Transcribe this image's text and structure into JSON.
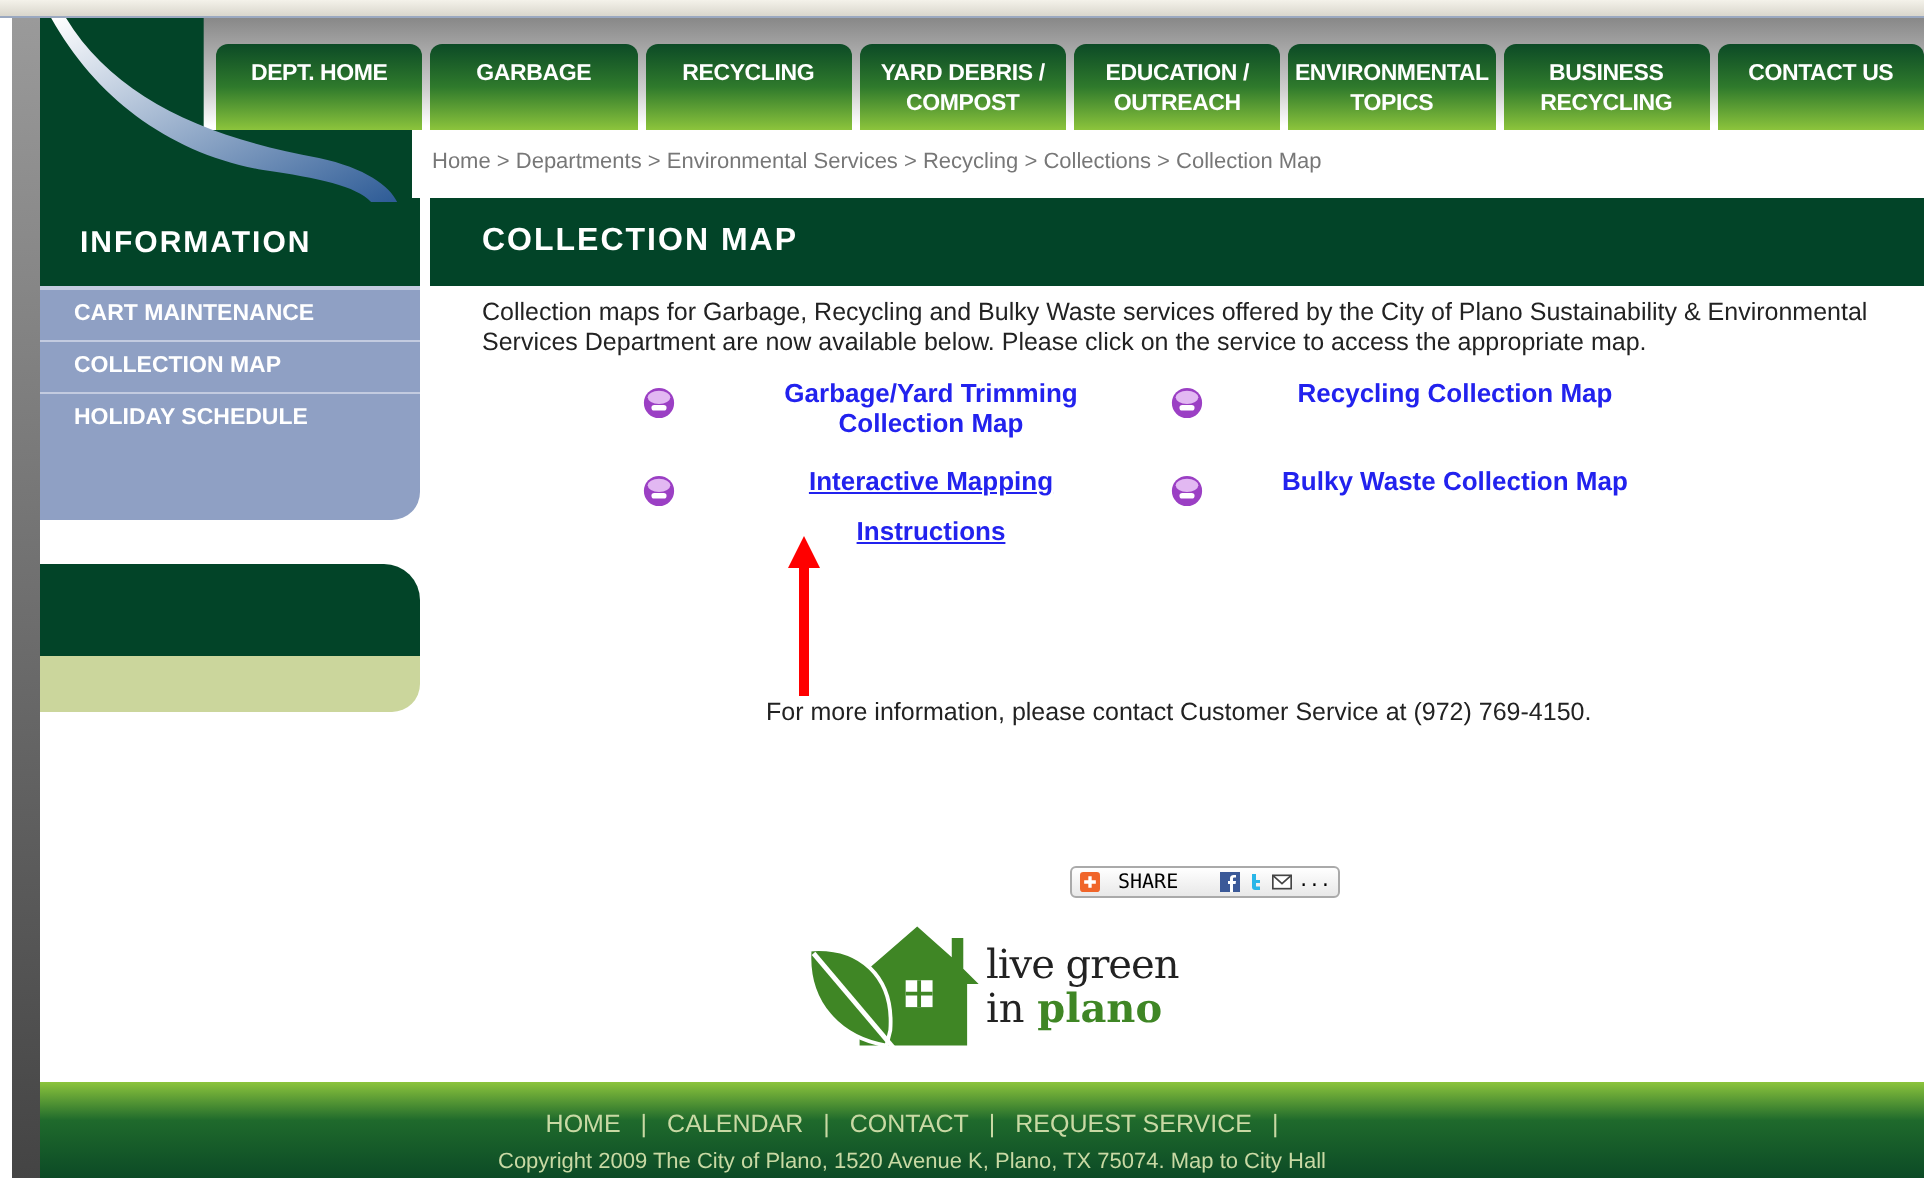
{
  "tabs": [
    {
      "label": "DEPT. HOME"
    },
    {
      "label": "GARBAGE"
    },
    {
      "label": "RECYCLING"
    },
    {
      "label": "YARD DEBRIS / COMPOST"
    },
    {
      "label": "EDUCATION / OUTREACH"
    },
    {
      "label": "ENVIRONMENTAL TOPICS"
    },
    {
      "label": "BUSINESS RECYCLING"
    },
    {
      "label": "CONTACT US"
    }
  ],
  "breadcrumb": "Home > Departments > Environmental Services > Recycling > Collections > Collection Map",
  "sidebar": {
    "title": "INFORMATION",
    "items": [
      {
        "label": "CART MAINTENANCE"
      },
      {
        "label": "COLLECTION MAP"
      },
      {
        "label": "HOLIDAY SCHEDULE"
      }
    ]
  },
  "page_title": "COLLECTION MAP",
  "intro": "Collection maps for Garbage, Recycling and Bulky Waste services offered by the City of Plano Sustainability & Environmental Services Department are now available below.  Please click on the service to access the appropriate map.",
  "map_links": [
    {
      "label": "Garbage/Yard Trimming Collection Map",
      "underlined": false
    },
    {
      "label": "Recycling Collection Map",
      "underlined": false
    },
    {
      "label": "Interactive Mapping",
      "underlined": true,
      "sub_link": "Instructions"
    },
    {
      "label": "Bulky Waste Collection Map",
      "underlined": false
    }
  ],
  "contact_note": "For more information, please contact Customer Service at (972) 769-4150.",
  "share_button": {
    "label": "SHARE",
    "more": "..."
  },
  "logo": {
    "line_1": "live green",
    "line_2_a": "in",
    "line_2_b": "plano"
  },
  "footer": {
    "links": [
      "HOME",
      "CALENDAR",
      "CONTACT",
      "REQUEST SERVICE"
    ],
    "separator": "|",
    "copyright": "Copyright 2009 The City of Plano, 1520 Avenue K, Plano, TX 75074.",
    "copyright_link": "Map to City Hall"
  }
}
